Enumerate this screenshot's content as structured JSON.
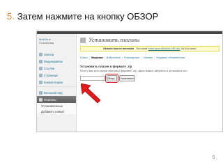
{
  "slide": {
    "step_number": "5.",
    "title": "Затем нажмите на кнопку ОБЗОР",
    "page_number": "5"
  },
  "colors": {
    "step_number": "#d9822b",
    "admin_bar": "#464646",
    "link": "#21759b",
    "notice_bg": "#fffbcc",
    "highlight": "#e01b1b"
  },
  "sidebar": {
    "brand_line1": "Мой блог",
    "brand_line2": "Статистика",
    "items": [
      {
        "label": "Записи",
        "icon": "pin-icon"
      },
      {
        "label": "Медиафайлы",
        "icon": "media-icon"
      },
      {
        "label": "Ссылки",
        "icon": "link-icon"
      },
      {
        "label": "Страницы",
        "icon": "page-icon"
      },
      {
        "label": "Комментарии",
        "icon": "comment-icon"
      },
      {
        "label": "Внешний вид",
        "icon": "appearance-icon"
      },
      {
        "label": "Плагины",
        "icon": "plugin-icon"
      },
      {
        "label": "Установленные",
        "icon": ""
      },
      {
        "label": "Добавить новый",
        "icon": ""
      }
    ]
  },
  "main": {
    "page_title": "Установить плагины",
    "notice_bold": "Akismet почти включён.",
    "notice_text": "You must",
    "notice_link": "enter your Akismet API key",
    "notice_end": "for it to work.",
    "tabs": [
      {
        "label": "Поиск"
      },
      {
        "label": "Загрузка"
      },
      {
        "label": "Избранные"
      },
      {
        "label": "Популярные"
      },
      {
        "label": "Свежие"
      },
      {
        "label": "Недавно обновлённые"
      }
    ],
    "upload_heading": "Установить плагин в формате .zip",
    "upload_desc": "Если у вас есть архив плагина в формате .zip, здесь можно загрузить и установить его.",
    "browse_label": "Обзор...",
    "install_label": "Установить"
  }
}
